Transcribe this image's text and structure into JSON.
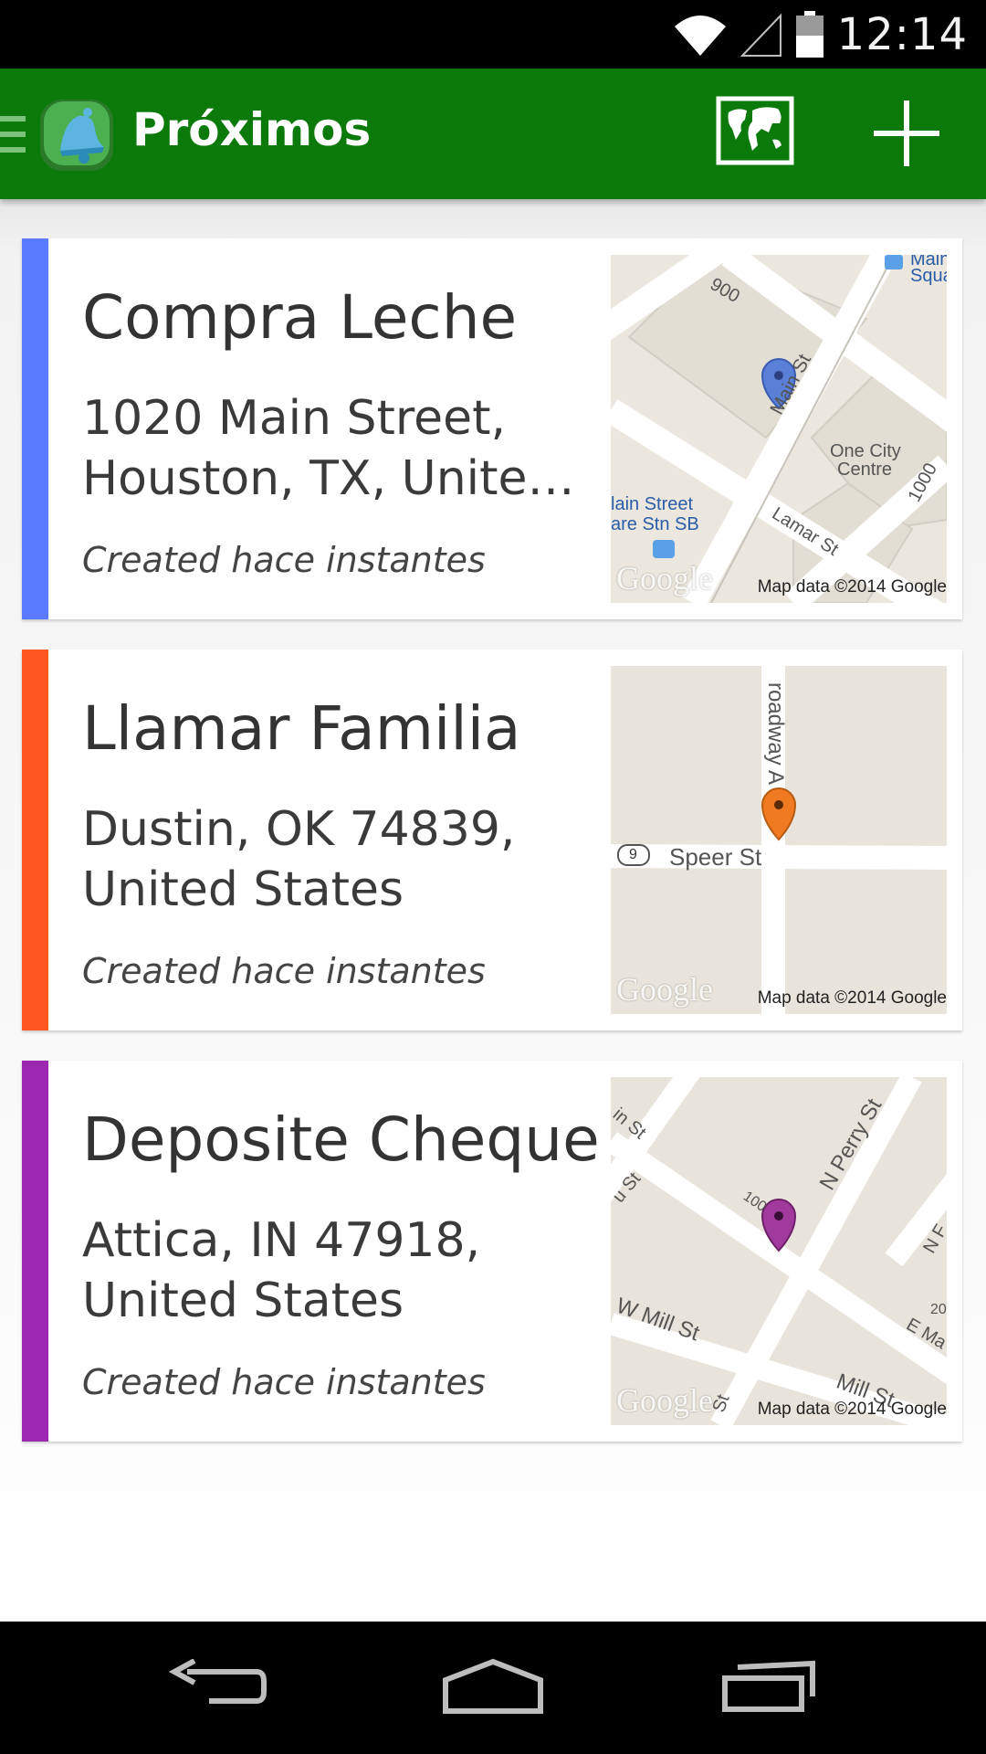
{
  "status_bar": {
    "time": "12:14"
  },
  "app_bar": {
    "title": "Próximos"
  },
  "reminders": [
    {
      "title": "Compra Leche",
      "address_line1": "1020 Main Street,",
      "address_line2": "Houston, TX, United States",
      "created": "Created hace instantes",
      "color": "#5a7bff",
      "pin_color": "#5a7fd6",
      "map": {
        "labels": [
          "900",
          "Main St",
          "One City",
          "Centre",
          "1000",
          "Lamar St",
          "lain Street",
          "are Stn SB",
          "Main",
          "Squa"
        ],
        "google": "Google",
        "attribution": "Map data ©2014 Google"
      }
    },
    {
      "title": "Llamar Familia",
      "address_line1": "Dustin, OK 74839,",
      "address_line2": "United States",
      "created": "Created hace instantes",
      "color": "#ff5722",
      "pin_color": "#f07a22",
      "map": {
        "labels": [
          "roadway A",
          "9",
          "Speer St"
        ],
        "google": "Google",
        "attribution": "Map data ©2014 Google"
      }
    },
    {
      "title": "Deposite Cheque",
      "address_line1": "Attica, IN 47918,",
      "address_line2": "United States",
      "created": "Created hace instantes",
      "color": "#9c27b0",
      "pin_color": "#a03a9c",
      "map": {
        "labels": [
          "in St",
          "u St",
          "N Perry St",
          "100",
          "N F",
          "20",
          "E Ma",
          "W Mill St",
          "Mill St",
          "St"
        ],
        "google": "Google",
        "attribution": "Map data ©2014 Google"
      }
    }
  ],
  "icons": {
    "wifi": "wifi-icon",
    "signal": "signal-icon",
    "battery": "battery-icon",
    "drawer": "drawer-icon",
    "logo": "bell-logo-icon",
    "map": "world-map-icon",
    "add": "plus-icon",
    "back": "back-icon",
    "home": "home-icon",
    "recents": "recents-icon"
  },
  "colors": {
    "action_bar": "#0b7a0b",
    "status_bar": "#000000"
  }
}
